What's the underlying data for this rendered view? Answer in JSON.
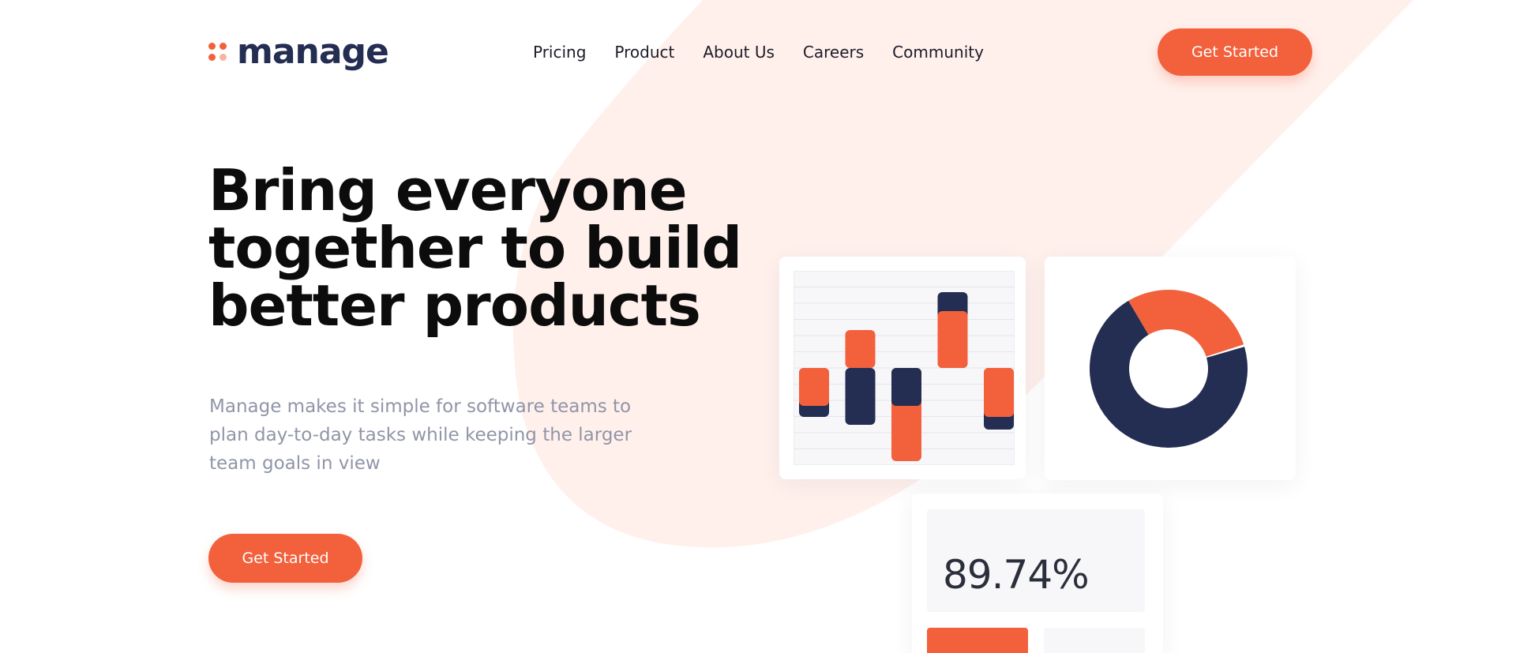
{
  "brand": {
    "name": "manage",
    "accent_color": "#f3603c",
    "dark_color": "#242d52",
    "logo_icon": "four-dots-logo-icon"
  },
  "nav": {
    "items": [
      {
        "label": "Pricing"
      },
      {
        "label": "Product"
      },
      {
        "label": "About Us"
      },
      {
        "label": "Careers"
      },
      {
        "label": "Community"
      }
    ],
    "cta_label": "Get Started"
  },
  "hero": {
    "title_lines": [
      "Bring everyone",
      "together to build",
      "better products"
    ],
    "description_lines": [
      "Manage makes it simple for software teams to",
      "plan day-to-day tasks while keeping the larger",
      "team goals in view"
    ],
    "cta_label": "Get Started"
  },
  "dashboard": {
    "bar_chart": {
      "colors": {
        "orange": "#f3603c",
        "navy": "#242d52"
      },
      "columns": [
        {
          "navy": -0.62,
          "orange": -0.48
        },
        {
          "orange": 0.48,
          "navy": -0.72
        },
        {
          "navy": -0.48,
          "orange": -1.18
        },
        {
          "navy": 0.96,
          "orange": 0.72
        },
        {
          "orange": -0.62,
          "navy": -0.78
        }
      ]
    },
    "donut_chart": {
      "segments": [
        {
          "color": "#f3603c",
          "fraction": 0.29
        },
        {
          "color": "#242d52",
          "fraction": 0.71
        }
      ]
    },
    "stat": {
      "value": "89.74%"
    }
  }
}
